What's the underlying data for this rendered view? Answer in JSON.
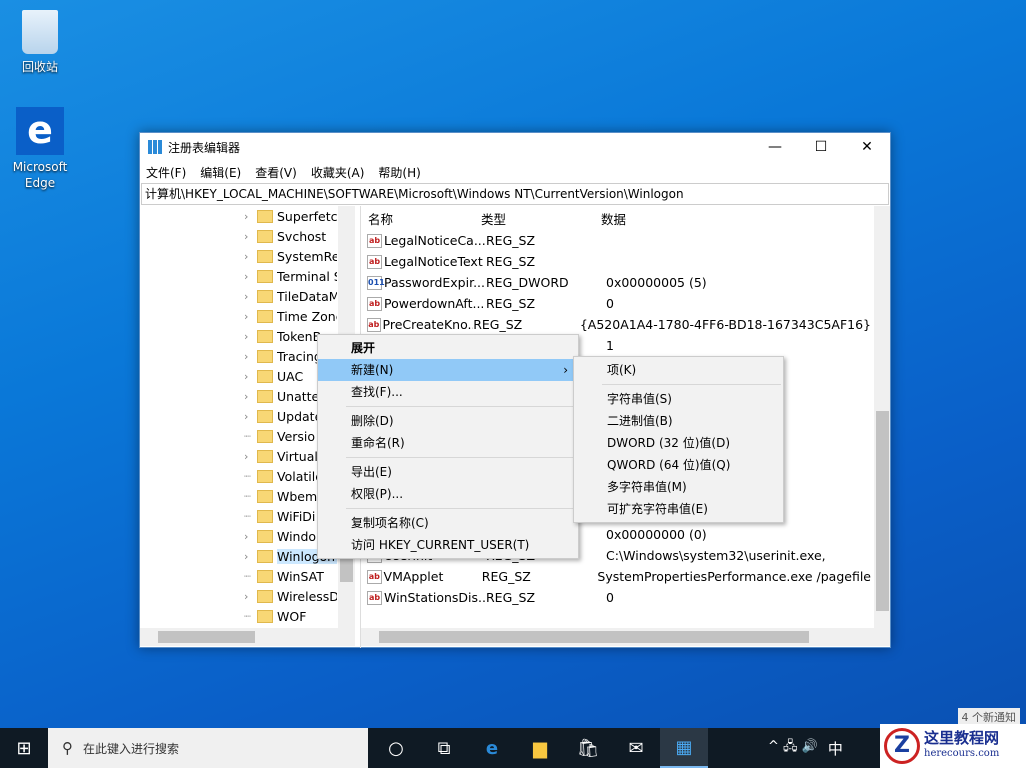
{
  "desktop": {
    "recycle_bin": "回收站",
    "edge": "Microsoft Edge"
  },
  "window": {
    "title": "注册表编辑器",
    "minimize": "—",
    "maximize": "☐",
    "close": "✕",
    "menu": [
      "文件(F)",
      "编辑(E)",
      "查看(V)",
      "收藏夹(A)",
      "帮助(H)"
    ],
    "address": "计算机\\HKEY_LOCAL_MACHINE\\SOFTWARE\\Microsoft\\Windows NT\\CurrentVersion\\Winlogon"
  },
  "tree": [
    {
      "label": "Superfetch",
      "exp": true
    },
    {
      "label": "Svchost",
      "exp": true
    },
    {
      "label": "SystemRes",
      "exp": true
    },
    {
      "label": "Terminal S",
      "exp": true
    },
    {
      "label": "TileDataM",
      "exp": true
    },
    {
      "label": "Time Zone",
      "exp": true
    },
    {
      "label": "TokenB",
      "exp": true
    },
    {
      "label": "Tracing",
      "exp": true
    },
    {
      "label": "UAC",
      "exp": true
    },
    {
      "label": "Unatte",
      "exp": true
    },
    {
      "label": "Update",
      "exp": true
    },
    {
      "label": "Versio",
      "exp": false
    },
    {
      "label": "Virtuali",
      "exp": true
    },
    {
      "label": "Volatile",
      "exp": false
    },
    {
      "label": "Wbem",
      "exp": false
    },
    {
      "label": "WiFiDi",
      "exp": false
    },
    {
      "label": "Windo",
      "exp": true
    },
    {
      "label": "Winlogon",
      "exp": true,
      "selected": true
    },
    {
      "label": "WinSAT",
      "exp": false
    },
    {
      "label": "WirelessD",
      "exp": true
    },
    {
      "label": "WOF",
      "exp": false
    }
  ],
  "list": {
    "headers": [
      "名称",
      "类型",
      "数据"
    ],
    "rows": [
      {
        "icon": "ab",
        "name": "LegalNoticeCa...",
        "type": "REG_SZ",
        "data": ""
      },
      {
        "icon": "ab",
        "name": "LegalNoticeText",
        "type": "REG_SZ",
        "data": ""
      },
      {
        "icon": "bin",
        "name": "PasswordExpir...",
        "type": "REG_DWORD",
        "data": "0x00000005 (5)"
      },
      {
        "icon": "ab",
        "name": "PowerdownAft...",
        "type": "REG_SZ",
        "data": "0"
      },
      {
        "icon": "ab",
        "name": "PreCreateKno...",
        "type": "REG_SZ",
        "data": "{A520A1A4-1780-4FF6-BD18-167343C5AF16}"
      },
      {
        "icon": "",
        "name": "",
        "type": "",
        "data": "1"
      },
      {
        "icon": "",
        "name": "",
        "type": "",
        "data": ""
      },
      {
        "icon": "",
        "name": "",
        "type": "",
        "data": ""
      },
      {
        "icon": "",
        "name": "",
        "type": "",
        "data": ""
      },
      {
        "icon": "",
        "name": "",
        "type": "",
        "data": ""
      },
      {
        "icon": "",
        "name": "",
        "type": "",
        "data": ""
      },
      {
        "icon": "",
        "name": "",
        "type": "",
        "data": ""
      },
      {
        "icon": "",
        "name": "",
        "type": "",
        "data": ""
      },
      {
        "icon": "",
        "name": "",
        "type": "",
        "data": ""
      },
      {
        "icon": "",
        "name": "",
        "type": "",
        "data": "0x00000000 (0)"
      },
      {
        "icon": "ab",
        "name": "Userinit",
        "type": "REG_SZ",
        "data": "C:\\Windows\\system32\\userinit.exe,"
      },
      {
        "icon": "ab",
        "name": "VMApplet",
        "type": "REG_SZ",
        "data": "SystemPropertiesPerformance.exe /pagefile"
      },
      {
        "icon": "ab",
        "name": "WinStationsDis...",
        "type": "REG_SZ",
        "data": "0"
      }
    ]
  },
  "context_menu": [
    {
      "label": "展开",
      "bold": true
    },
    {
      "label": "新建(N)",
      "highlight": true,
      "arrow": "›"
    },
    {
      "label": "查找(F)..."
    },
    {
      "sep": true
    },
    {
      "label": "删除(D)"
    },
    {
      "label": "重命名(R)"
    },
    {
      "sep": true
    },
    {
      "label": "导出(E)"
    },
    {
      "label": "权限(P)..."
    },
    {
      "sep": true
    },
    {
      "label": "复制项名称(C)"
    },
    {
      "label": "访问 HKEY_CURRENT_USER(T)"
    }
  ],
  "submenu": [
    {
      "label": "项(K)"
    },
    {
      "sep": true
    },
    {
      "label": "字符串值(S)"
    },
    {
      "label": "二进制值(B)"
    },
    {
      "label": "DWORD (32 位)值(D)"
    },
    {
      "label": "QWORD (64 位)值(Q)"
    },
    {
      "label": "多字符串值(M)"
    },
    {
      "label": "可扩充字符串值(E)"
    }
  ],
  "taskbar": {
    "search_placeholder": "在此键入进行搜索",
    "tray": "^ 🖧 🔊",
    "ime": "中",
    "notification": "4 个新通知"
  },
  "watermark": {
    "title": "这里教程网",
    "url": "herecours.com"
  }
}
